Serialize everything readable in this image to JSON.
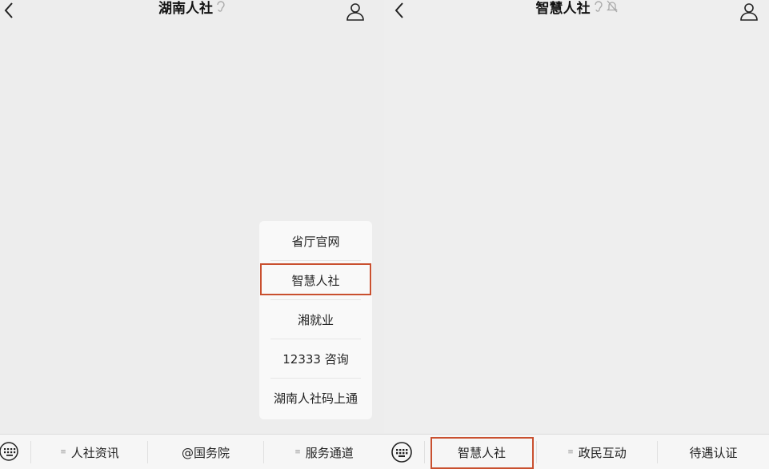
{
  "left": {
    "title": "湖南人社",
    "menu_tabs": [
      "人社资讯",
      "@国务院",
      "服务通道"
    ],
    "popup_items": [
      "省厅官网",
      "智慧人社",
      "湘就业",
      "12333 咨询",
      "湖南人社码上通"
    ]
  },
  "right": {
    "title": "智慧人社",
    "menu_tabs": [
      "智慧人社",
      "政民互动",
      "待遇认证"
    ]
  },
  "colors": {
    "highlight": "#c9502f",
    "background": "#ededed"
  },
  "icons": [
    "back-icon",
    "ear-icon",
    "mute-icon",
    "user-icon",
    "keyboard-icon",
    "menu-icon"
  ]
}
